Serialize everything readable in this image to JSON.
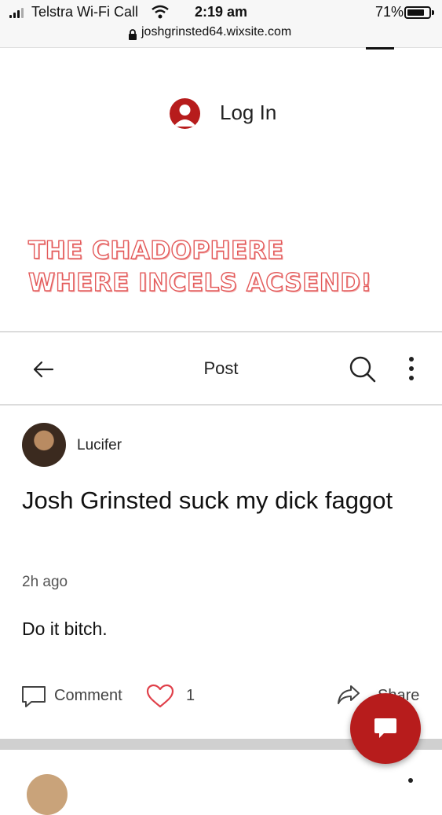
{
  "status_bar": {
    "carrier": "Telstra Wi-Fi Call",
    "time": "2:19 am",
    "battery": "71%",
    "battery_level": 0.71
  },
  "browser": {
    "url": "joshgrinsted64.wixsite.com"
  },
  "site": {
    "login_label": "Log In",
    "banner_line1": "THE CHADOPHERE",
    "banner_line2": "WHERE INCELS ACSEND!",
    "banner_color": "#e35a5a"
  },
  "post_nav": {
    "title": "Post",
    "icons": [
      "back-arrow-icon",
      "search-icon",
      "more-vert-icon"
    ]
  },
  "post": {
    "author": "Lucifer",
    "heading": "Josh Grinsted suck my dick faggot",
    "time": "2h ago",
    "body": "Do it bitch.",
    "comment_label": "Comment",
    "like_count": "1",
    "share_label": "Share"
  },
  "colors": {
    "accent": "#b71c1c"
  }
}
